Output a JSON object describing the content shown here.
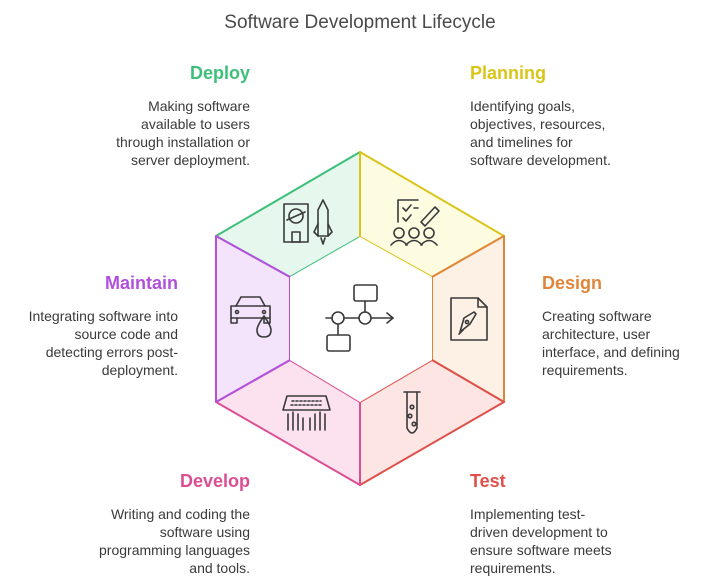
{
  "title": "Software Development Lifecycle",
  "stages": {
    "deploy": {
      "name": "Deploy",
      "color": "#3dbf7a",
      "fill": "#e6f7ee",
      "description": "Making software\navailable to users\nthrough installation or\nserver deployment.",
      "icon": "rocket-icon"
    },
    "planning": {
      "name": "Planning",
      "color": "#d9c51a",
      "fill": "#fdfbe0",
      "description": "Identifying goals,\nobjectives, resources,\nand timelines for\nsoftware development.",
      "icon": "checklist-team-icon"
    },
    "design": {
      "name": "Design",
      "color": "#e0863a",
      "fill": "#fdf0e4",
      "description": "Creating software\narchitecture, user\ninterface, and defining\nrequirements.",
      "icon": "pen-document-icon"
    },
    "test": {
      "name": "Test",
      "color": "#e0504a",
      "fill": "#fce5e3",
      "description": "Implementing test-\ndriven development to\nensure software meets\nrequirements.",
      "icon": "test-tube-icon"
    },
    "develop": {
      "name": "Develop",
      "color": "#dc4e92",
      "fill": "#fbe2ee",
      "description": "Writing and coding the\nsoftware using\nprogramming languages\nand tools.",
      "icon": "keyboard-hands-icon"
    },
    "maintain": {
      "name": "Maintain",
      "color": "#b24fdc",
      "fill": "#f3e3fb",
      "description": "Integrating software into\nsource code and\ndetecting errors post-\ndeployment.",
      "icon": "car-oil-icon"
    }
  },
  "center_icon": "workflow-icon"
}
